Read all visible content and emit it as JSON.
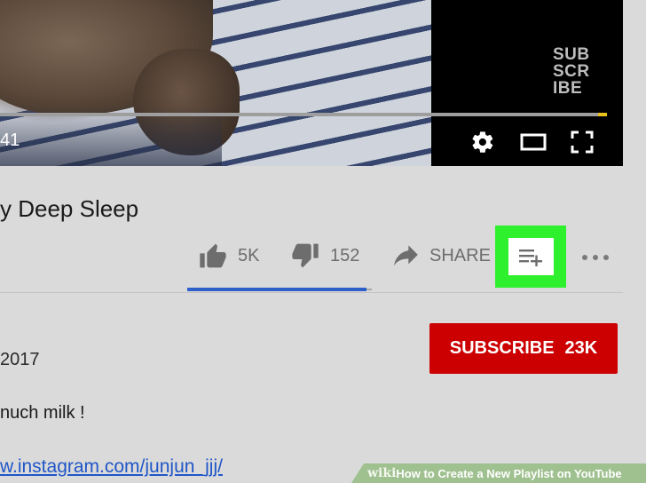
{
  "player": {
    "time_display": "41",
    "watermark_lines": [
      "SUB",
      "SCR",
      "IBE"
    ],
    "progress_fraction": 0.985,
    "controls": [
      {
        "name": "settings-button",
        "icon": "gear-icon"
      },
      {
        "name": "theater-mode-button",
        "icon": "theater-icon"
      },
      {
        "name": "fullscreen-button",
        "icon": "fullscreen-icon"
      }
    ]
  },
  "video": {
    "title": "y Deep Sleep"
  },
  "actions": {
    "like_count": "5K",
    "like_icon": "thumbs-up-icon",
    "dislike_count": "152",
    "dislike_icon": "thumbs-down-icon",
    "share_label": "SHARE",
    "share_icon": "share-arrow-icon",
    "save_icon": "add-to-playlist-icon",
    "more_icon": "more-horizontal-icon",
    "like_ratio": 0.97
  },
  "channel": {
    "subscribe_label": "SUBSCRIBE",
    "subscriber_count": "23K",
    "publish_date": "2017"
  },
  "description": {
    "line1": "nuch milk !",
    "link": "w.instagram.com/junjun_jjj/"
  },
  "banner": {
    "brand": "wiki",
    "text": "How to Create a New Playlist on YouTube"
  },
  "colors": {
    "subscribe_red": "#cc0000",
    "highlight_green": "#2ef02c",
    "link_blue": "#1f56c8",
    "sentiment_blue": "#2d5fcb",
    "progress_yellow": "#e8c21a"
  }
}
